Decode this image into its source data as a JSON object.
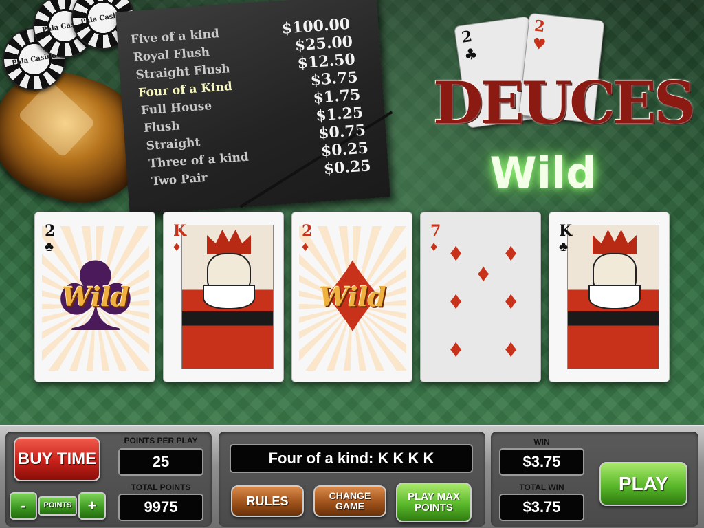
{
  "chips": [
    "Pala Casino",
    "Pala Casino",
    "Pala Casino"
  ],
  "paytable": [
    {
      "hand": "Five of a kind",
      "payout": "$100.00",
      "hit": false
    },
    {
      "hand": "Royal Flush",
      "payout": "$25.00",
      "hit": false
    },
    {
      "hand": "Straight Flush",
      "payout": "$12.50",
      "hit": false
    },
    {
      "hand": "Four of a Kind",
      "payout": "$3.75",
      "hit": true
    },
    {
      "hand": "Full House",
      "payout": "$1.75",
      "hit": false
    },
    {
      "hand": "Flush",
      "payout": "$1.25",
      "hit": false
    },
    {
      "hand": "Straight",
      "payout": "$0.75",
      "hit": false
    },
    {
      "hand": "Three of a kind",
      "payout": "$0.25",
      "hit": false
    },
    {
      "hand": "Two Pair",
      "payout": "$0.25",
      "hit": false
    }
  ],
  "logo": {
    "title": "DEUCES",
    "subtitle": "Wild",
    "card_left_rank": "2",
    "card_left_suit": "♣",
    "card_right_rank": "2",
    "card_right_suit": "♥"
  },
  "cards": [
    {
      "rank": "2",
      "suit": "♣",
      "color": "black",
      "type": "wild",
      "wild_text": "Wild"
    },
    {
      "rank": "K",
      "suit": "♦",
      "color": "red",
      "type": "face"
    },
    {
      "rank": "2",
      "suit": "♦",
      "color": "red",
      "type": "wild",
      "wild_text": "Wild"
    },
    {
      "rank": "7",
      "suit": "♦",
      "color": "red",
      "type": "pips"
    },
    {
      "rank": "K",
      "suit": "♣",
      "color": "black",
      "type": "face"
    }
  ],
  "panel": {
    "buy_time": "BUY TIME",
    "points_label": "POINTS",
    "minus": "-",
    "plus": "+",
    "points_per_play_label": "POINTS PER PLAY",
    "points_per_play": "25",
    "total_points_label": "TOTAL POINTS",
    "total_points": "9975",
    "message": "Four of a kind:  K K K K",
    "rules": "RULES",
    "change_game": "CHANGE GAME",
    "play_max": "PLAY MAX POINTS",
    "win_label": "WIN",
    "win": "$3.75",
    "total_win_label": "TOTAL WIN",
    "total_win": "$3.75",
    "play": "PLAY"
  },
  "colors": {
    "felt": "#2f6a3e",
    "wild_gold": "#f0b040",
    "play_green": "#5ab82a",
    "buy_red": "#c8201a",
    "card_red": "#c8321a"
  }
}
